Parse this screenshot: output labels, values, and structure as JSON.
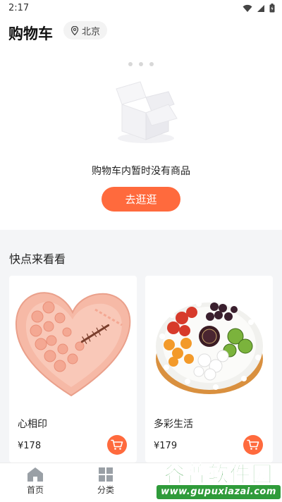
{
  "status_bar": {
    "time": "2:17"
  },
  "header": {
    "title": "购物车",
    "location": "北京"
  },
  "empty_cart": {
    "message": "购物车内暂时没有商品",
    "button_label": "去逛逛"
  },
  "recommend": {
    "title": "快点来看看",
    "products": [
      {
        "name": "心相印",
        "price": "¥178"
      },
      {
        "name": "多彩生活",
        "price": "¥179"
      }
    ]
  },
  "tab_bar": {
    "items": [
      {
        "label": "首页"
      },
      {
        "label": "分类"
      }
    ]
  },
  "watermark": {
    "title": "谷普软件园",
    "url": "www.gupuxiazai.com"
  },
  "colors": {
    "accent": "#ff6a3d",
    "section_bg": "#f4f5f7",
    "watermark_green": "#2f9b3a"
  }
}
